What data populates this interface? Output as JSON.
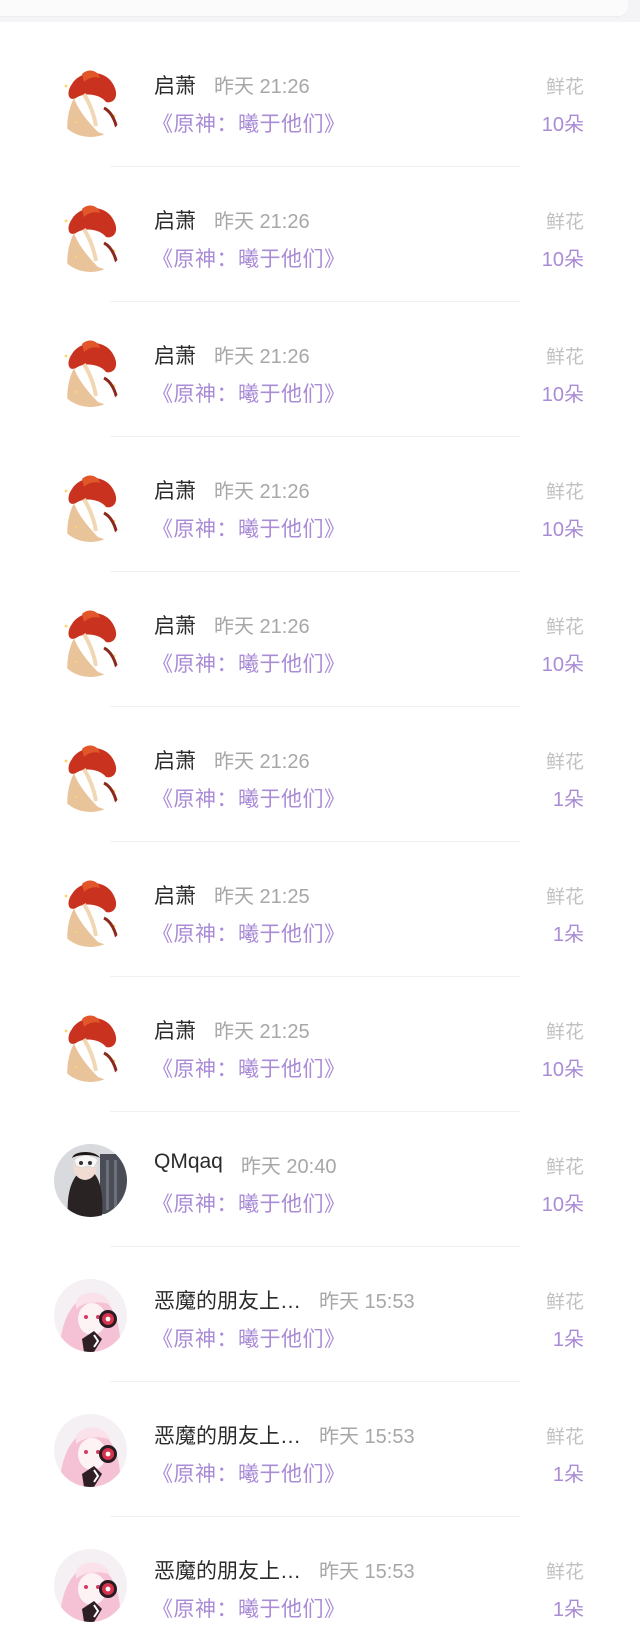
{
  "messages": [
    {
      "user": "启萧",
      "time": "昨天 21:26",
      "book": "《原神：曦于他们》",
      "gift_label": "鲜花",
      "gift_count": "10朵",
      "avatar": "avatar-red-hair"
    },
    {
      "user": "启萧",
      "time": "昨天 21:26",
      "book": "《原神：曦于他们》",
      "gift_label": "鲜花",
      "gift_count": "10朵",
      "avatar": "avatar-red-hair"
    },
    {
      "user": "启萧",
      "time": "昨天 21:26",
      "book": "《原神：曦于他们》",
      "gift_label": "鲜花",
      "gift_count": "10朵",
      "avatar": "avatar-red-hair"
    },
    {
      "user": "启萧",
      "time": "昨天 21:26",
      "book": "《原神：曦于他们》",
      "gift_label": "鲜花",
      "gift_count": "10朵",
      "avatar": "avatar-red-hair"
    },
    {
      "user": "启萧",
      "time": "昨天 21:26",
      "book": "《原神：曦于他们》",
      "gift_label": "鲜花",
      "gift_count": "10朵",
      "avatar": "avatar-red-hair"
    },
    {
      "user": "启萧",
      "time": "昨天 21:26",
      "book": "《原神：曦于他们》",
      "gift_label": "鲜花",
      "gift_count": "1朵",
      "avatar": "avatar-red-hair"
    },
    {
      "user": "启萧",
      "time": "昨天 21:25",
      "book": "《原神：曦于他们》",
      "gift_label": "鲜花",
      "gift_count": "1朵",
      "avatar": "avatar-red-hair"
    },
    {
      "user": "启萧",
      "time": "昨天 21:25",
      "book": "《原神：曦于他们》",
      "gift_label": "鲜花",
      "gift_count": "10朵",
      "avatar": "avatar-red-hair"
    },
    {
      "user": "QMqaq",
      "time": "昨天 20:40",
      "book": "《原神：曦于他们》",
      "gift_label": "鲜花",
      "gift_count": "10朵",
      "avatar": "avatar-masked-girl"
    },
    {
      "user": "恶魔的朋友上…",
      "time": "昨天 15:53",
      "book": "《原神：曦于他们》",
      "gift_label": "鲜花",
      "gift_count": "1朵",
      "avatar": "avatar-pink-headphones"
    },
    {
      "user": "恶魔的朋友上…",
      "time": "昨天 15:53",
      "book": "《原神：曦于他们》",
      "gift_label": "鲜花",
      "gift_count": "1朵",
      "avatar": "avatar-pink-headphones"
    },
    {
      "user": "恶魔的朋友上…",
      "time": "昨天 15:53",
      "book": "《原神：曦于他们》",
      "gift_label": "鲜花",
      "gift_count": "1朵",
      "avatar": "avatar-pink-headphones"
    }
  ],
  "colors": {
    "accent": "#a98bd6",
    "muted": "#a7a7a7",
    "label": "#c1c1c1",
    "name": "#2b2b2b"
  }
}
